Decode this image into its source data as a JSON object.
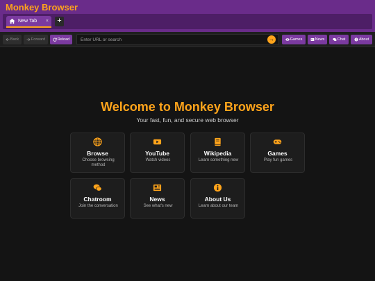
{
  "app": {
    "title": "Monkey Browser"
  },
  "tabs": [
    {
      "label": "New Tab",
      "close": "×",
      "active": true
    }
  ],
  "new_tab": "+",
  "toolbar": {
    "back": "Back",
    "forward": "Forward",
    "reload": "Reload",
    "url_placeholder": "Enter URL or search",
    "go": "→",
    "quick_links": [
      "Games",
      "News",
      "Chat",
      "About"
    ]
  },
  "hero": {
    "title": "Welcome to Monkey Browser",
    "subtitle": "Your fast, fun, and secure web browser"
  },
  "cards": [
    {
      "title": "Browse",
      "desc": "Choose browsing method",
      "icon": "globe-icon"
    },
    {
      "title": "YouTube",
      "desc": "Watch videos",
      "icon": "video-icon"
    },
    {
      "title": "Wikipedia",
      "desc": "Learn something new",
      "icon": "book-icon"
    },
    {
      "title": "Games",
      "desc": "Play fun games",
      "icon": "gamepad-icon"
    },
    {
      "title": "Chatroom",
      "desc": "Join the conversation",
      "icon": "chat-icon"
    },
    {
      "title": "News",
      "desc": "See what's new",
      "icon": "newspaper-icon"
    },
    {
      "title": "About Us",
      "desc": "Learn about our team",
      "icon": "info-icon"
    }
  ],
  "colors": {
    "accent": "#ffa41b",
    "brand_purple": "#6a2c8a",
    "tab_purple": "#7b3aa0",
    "background": "#141414",
    "card": "#1d1d1d"
  }
}
